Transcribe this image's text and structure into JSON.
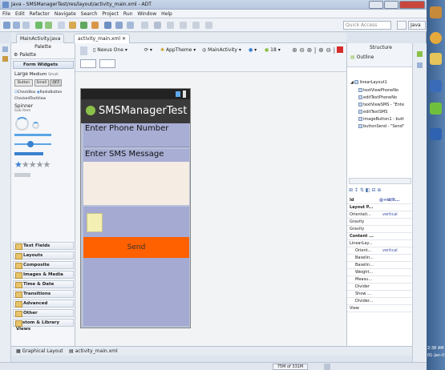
{
  "window": {
    "title": "Java - SMSManagerTest/res/layout/activity_main.xml - ADT"
  },
  "menu": [
    "File",
    "Edit",
    "Refactor",
    "Navigate",
    "Search",
    "Project",
    "Run",
    "Window",
    "Help"
  ],
  "toolbar": {
    "quick_access_placeholder": "Quick Access",
    "perspective": "Java"
  },
  "editor_tabs": [
    {
      "label": "MainActivity.java",
      "active": false
    },
    {
      "label": "activity_main.xml",
      "active": true
    }
  ],
  "palette": {
    "view_label": "Palette",
    "title": "Palette",
    "section": "Form Widgets",
    "text_sizes": [
      "Large",
      "Medium",
      "Small"
    ],
    "button_labels": [
      "Button",
      "Small",
      "OFF"
    ],
    "check_labels": [
      "CheckBox",
      "RadioButton"
    ],
    "checked_text": "CheckedTextView",
    "spinner_label": "Spinner",
    "spinner_sub": "Sub Item",
    "categories": [
      "Text Fields",
      "Layouts",
      "Composite",
      "Images & Media",
      "Time & Date",
      "Transitions",
      "Advanced",
      "Other",
      "Custom & Library Views"
    ]
  },
  "canvas_toolbar": {
    "device": "Nexus One",
    "theme": "AppTheme",
    "activity": "MainActivity",
    "api": "18"
  },
  "device_preview": {
    "app_title": "SMSManagerTest",
    "phone_label": "Enter Phone Number",
    "sms_label": "Enter SMS Message",
    "send_label": "Send"
  },
  "outline": {
    "structure_label": "Structure",
    "title": "Outline",
    "root": "linearLayout1",
    "items": [
      "textViewPhoneNo",
      "editTextPhoneNo",
      "textViewSMS - \"Ente",
      "editTextSMS",
      "imageButton1 - butt",
      "buttonSend - \"Send\""
    ]
  },
  "properties": {
    "id_label": "Id",
    "id_value": "@+id/li...",
    "rows": [
      {
        "name": "Layout P...",
        "value": ""
      },
      {
        "name": "Orientati...",
        "value": "vertical"
      },
      {
        "name": "Gravity",
        "value": ""
      },
      {
        "name": "Gravity",
        "value": ""
      },
      {
        "name": "Content ...",
        "value": ""
      },
      {
        "name": "LinearLay...",
        "value": ""
      },
      {
        "name": "Orient...",
        "value": "vertical"
      },
      {
        "name": "Baselin...",
        "value": ""
      },
      {
        "name": "Baselin...",
        "value": ""
      },
      {
        "name": "Weight...",
        "value": ""
      },
      {
        "name": "Measu...",
        "value": ""
      },
      {
        "name": "Divider",
        "value": ""
      },
      {
        "name": "Show ...",
        "value": ""
      },
      {
        "name": "Divider...",
        "value": ""
      },
      {
        "name": "View",
        "value": ""
      }
    ]
  },
  "bottom_tabs": {
    "graphical": "Graphical Layout",
    "xml": "activity_main.xml"
  },
  "status": {
    "memory": "75M of 331M"
  },
  "taskbar": {
    "time": "2:38 AM",
    "date": "01-Jan-0"
  },
  "colors": {
    "send_button": "#ff6000",
    "field_bg": "#a8aed4"
  }
}
